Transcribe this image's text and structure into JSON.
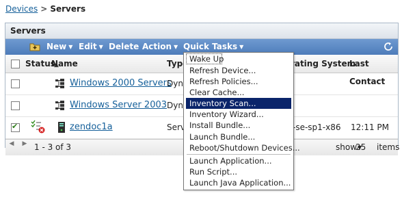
{
  "breadcrumb": {
    "parent": "Devices",
    "separator": ">",
    "current": "Servers"
  },
  "panel": {
    "title": "Servers"
  },
  "toolbar": {
    "new_label": "New",
    "edit_label": "Edit",
    "delete_label": "Delete",
    "action_label": "Action",
    "quick_tasks_label": "Quick Tasks"
  },
  "columns": {
    "status": "Status",
    "name": "Name",
    "sort_indicator": "▲",
    "type": "Type",
    "os": "Operating System",
    "last_contact": "Last Contact"
  },
  "rows": [
    {
      "name": "Windows 2000 Servers",
      "type": "Dyna",
      "os": "",
      "last_contact": "",
      "checked": false
    },
    {
      "name": "Windows Server 2003",
      "type": "Dyna",
      "os": "",
      "last_contact": "",
      "checked": false
    },
    {
      "name": "zendoc1a",
      "type": "Serv",
      "os": "-se-sp1-x86",
      "last_contact": "12:11 PM",
      "checked": true
    }
  ],
  "pager": {
    "range": "1 - 3 of 3",
    "show_label": "show",
    "page_size": "25",
    "items_label": "items"
  },
  "quick_tasks_menu": {
    "items": [
      "Wake Up",
      "Refresh Device...",
      "Refresh Policies...",
      "Clear Cache...",
      "Inventory Scan...",
      "Inventory Wizard...",
      "Install Bundle...",
      "Launch Bundle...",
      "Reboot/Shutdown Devices...",
      "Launch Application...",
      "Run Script...",
      "Launch Java Application..."
    ],
    "highlighted": "Inventory Scan..."
  },
  "colors": {
    "toolbar": "#5a88c6",
    "link": "#16609a",
    "highlight": "#0a246a"
  },
  "icons": [
    "new-folder-icon",
    "refresh-icon",
    "group-icon",
    "status-warning-icon",
    "server-icon"
  ]
}
